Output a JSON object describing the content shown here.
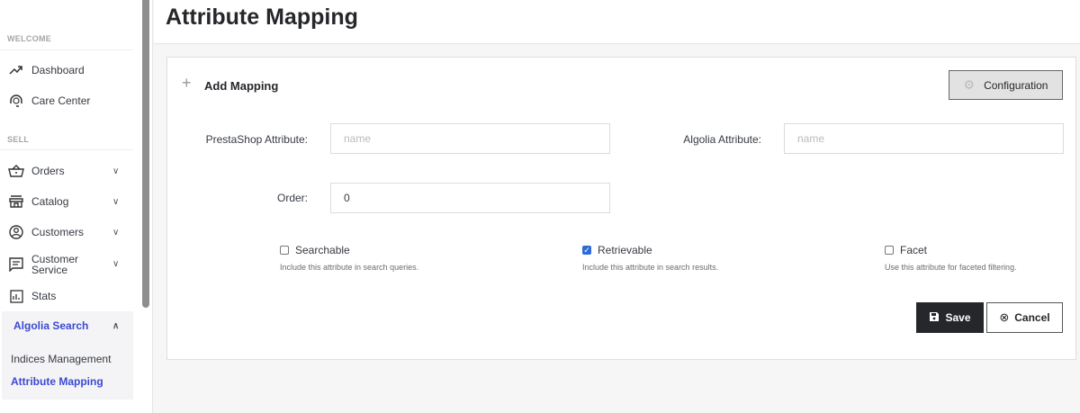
{
  "sidebar": {
    "sections": [
      "WELCOME",
      "SELL"
    ],
    "items": [
      {
        "label": "Dashboard",
        "icon": "trending-up-icon"
      },
      {
        "label": "Care Center",
        "icon": "headset-icon"
      },
      {
        "label": "Orders",
        "icon": "basket-icon"
      },
      {
        "label": "Catalog",
        "icon": "store-icon"
      },
      {
        "label": "Customers",
        "icon": "account-circle-icon"
      },
      {
        "label": "Customer Service",
        "icon": "chat-icon"
      },
      {
        "label": "Stats",
        "icon": "bar-chart-icon"
      }
    ],
    "active": {
      "label": "Algolia Search",
      "sub": [
        "Indices Management",
        "Attribute Mapping"
      ]
    }
  },
  "header": {
    "title": "Attribute Mapping"
  },
  "card": {
    "title": "Add Mapping",
    "config_label": "Configuration",
    "prestashop_label": "PrestaShop Attribute:",
    "prestashop_placeholder": "name",
    "algolia_label": "Algolia Attribute:",
    "algolia_placeholder": "name",
    "order_label": "Order:",
    "order_value": "0",
    "checkboxes": [
      {
        "label": "Searchable",
        "help": "Include this attribute in search queries.",
        "checked": false
      },
      {
        "label": "Retrievable",
        "help": "Include this attribute in search results.",
        "checked": true
      },
      {
        "label": "Facet",
        "help": "Use this attribute for faceted filtering.",
        "checked": false
      }
    ],
    "save_label": "Save",
    "cancel_label": "Cancel"
  },
  "colors": {
    "accent": "#3b4ad0",
    "dark_button": "#25272b"
  }
}
